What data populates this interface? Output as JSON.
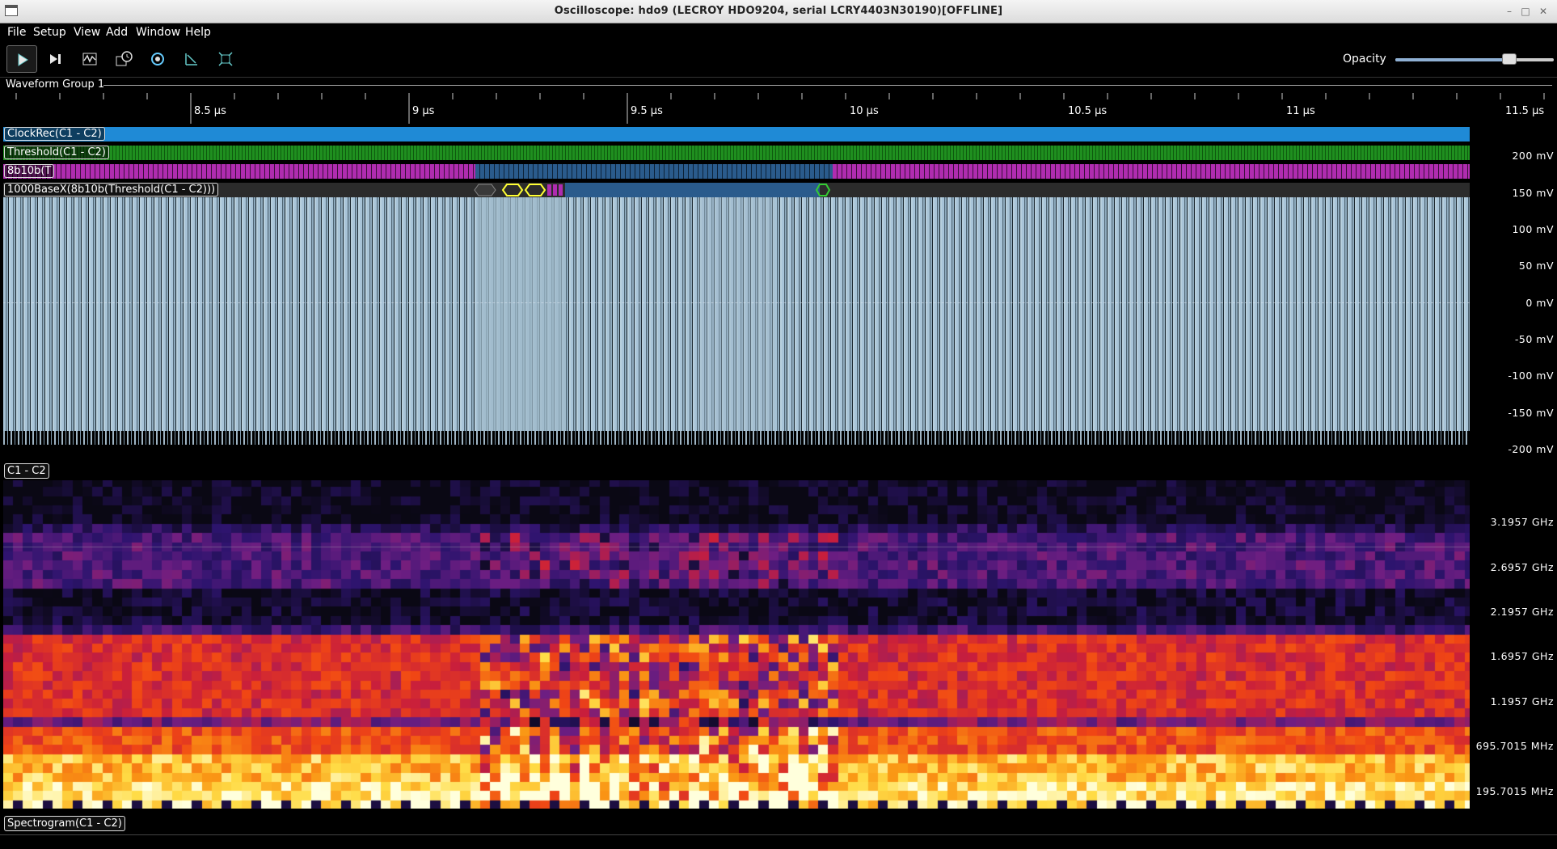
{
  "window": {
    "title": "Oscilloscope: hdo9 (LECROY HDO9204, serial LCRY4403N30190)[OFFLINE]"
  },
  "menu": [
    "File",
    "Setup",
    "View",
    "Add",
    "Window",
    "Help"
  ],
  "toolbar": {
    "buttons": [
      {
        "name": "start-trigger-button",
        "icon": "play-icon",
        "active": true
      },
      {
        "name": "single-trigger-button",
        "icon": "step-forward-icon"
      },
      {
        "name": "force-trigger-button",
        "icon": "waveform-icon"
      },
      {
        "name": "history-button",
        "icon": "clock-icon"
      },
      {
        "name": "sync-button",
        "icon": "refresh-icon"
      },
      {
        "name": "measure-button",
        "icon": "cursor-icon"
      },
      {
        "name": "fullscreen-button",
        "icon": "expand-icon"
      }
    ],
    "opacity_label": "Opacity",
    "opacity_value": 0.72
  },
  "group": {
    "label": "Waveform Group 1"
  },
  "timeline": {
    "unit": "µs",
    "ticks": [
      "8.5 µs",
      "9 µs",
      "9.5 µs",
      "10 µs",
      "10.5 µs",
      "11 µs",
      "11.5 µs"
    ]
  },
  "protocol_rows": {
    "clock": "ClockRec(C1 - C2)",
    "threshold": "Threshold(C1 - C2)",
    "decode_8b10b": "8b10b(T",
    "decode_1000basex": "1000BaseX(8b10b(Threshold(C1 - C2)))"
  },
  "waveform": {
    "channel_label": "C1 - C2",
    "y_axis": [
      "200 mV",
      "150 mV",
      "100 mV",
      "50 mV",
      "0 mV",
      "-50 mV",
      "-100 mV",
      "-150 mV",
      "-200 mV"
    ]
  },
  "spectrogram": {
    "label": "Spectrogram(C1 - C2)",
    "y_axis": [
      "3.1957 GHz",
      "2.6957 GHz",
      "2.1957 GHz",
      "1.6957 GHz",
      "1.1957 GHz",
      "695.7015 MHz",
      "195.7015 MHz"
    ]
  },
  "colors": {
    "clock": "#1f8ad6",
    "threshold": "#1f8f1f",
    "decode_8b10b": "#b02cb0",
    "decode_ctrl": "#2a5b8c",
    "waveform": "#a8c4d8",
    "packet_preamble": "#ffff33",
    "packet_end": "#33cc33"
  }
}
